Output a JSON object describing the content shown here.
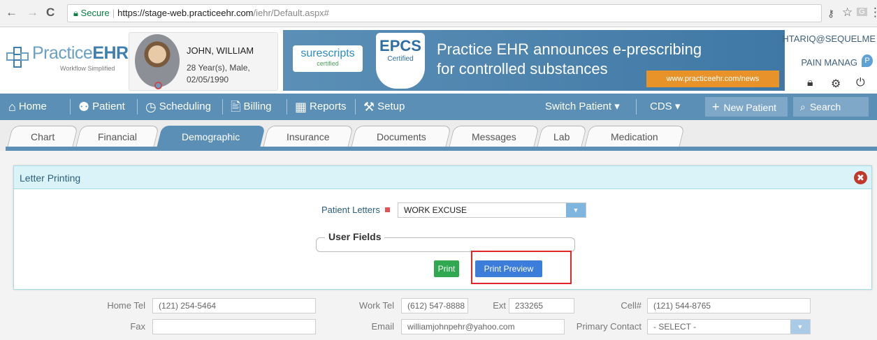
{
  "browser": {
    "back_icon": "←",
    "forward_icon": "→",
    "reload_icon": "C",
    "secure_label": "Secure",
    "url_host": "https://stage-web.practiceehr.com",
    "url_path": "/iehr/Default.aspx#",
    "key_icon": "⚷",
    "star_icon": "☆",
    "ext_icon": "G",
    "menu_icon": "⋮"
  },
  "header": {
    "logo_word": "Practice",
    "logo_bold": "EHR",
    "logo_tagline": "Workflow Simplified",
    "patient": {
      "name": "JOHN, WILLIAM",
      "age_sex": "28 Year(s), Male,",
      "dob": "02/05/1990"
    },
    "banner": {
      "surescripts": "surescripts",
      "surescripts_sub": "certified",
      "epcs": "EPCS",
      "epcs_sub": "Certified",
      "headline_1": "Practice EHR announces e-prescribing",
      "headline_2": "for controlled substances",
      "news_url": "www.practiceehr.com/news"
    },
    "user": {
      "username": "HTARIQ@SEQUELME",
      "location": "PAIN MANAG"
    }
  },
  "mainnav": {
    "home": "Home",
    "patient": "Patient",
    "scheduling": "Scheduling",
    "billing": "Billing",
    "reports": "Reports",
    "setup": "Setup",
    "switch_patient": "Switch Patient ▾",
    "cds": "CDS ▾",
    "new_patient": "New Patient",
    "search": "Search"
  },
  "subtabs": {
    "chart": "Chart",
    "financial": "Financial",
    "demographic": "Demographic",
    "insurance": "Insurance",
    "documents": "Documents",
    "messages": "Messages",
    "lab": "Lab",
    "medication": "Medication"
  },
  "form": {
    "home_tel_label": "Home Tel",
    "home_tel": "(121) 254-5464",
    "work_tel_label": "Work Tel",
    "work_tel": "(612) 547-8888",
    "ext_label": "Ext",
    "ext": "233265",
    "cell_label": "Cell#",
    "cell": "(121) 544-8765",
    "fax_label": "Fax",
    "fax": "",
    "email_label": "Email",
    "email": "williamjohnpehr@yahoo.com",
    "primary_contact_label": "Primary Contact",
    "primary_contact": "- SELECT -"
  },
  "modal": {
    "title": "Letter Printing",
    "close_icon": "✖",
    "letters_label": "Patient Letters",
    "letters_value": "WORK EXCUSE",
    "user_fields_legend": "User Fields",
    "print_label": "Print",
    "preview_label": "Print Preview"
  }
}
